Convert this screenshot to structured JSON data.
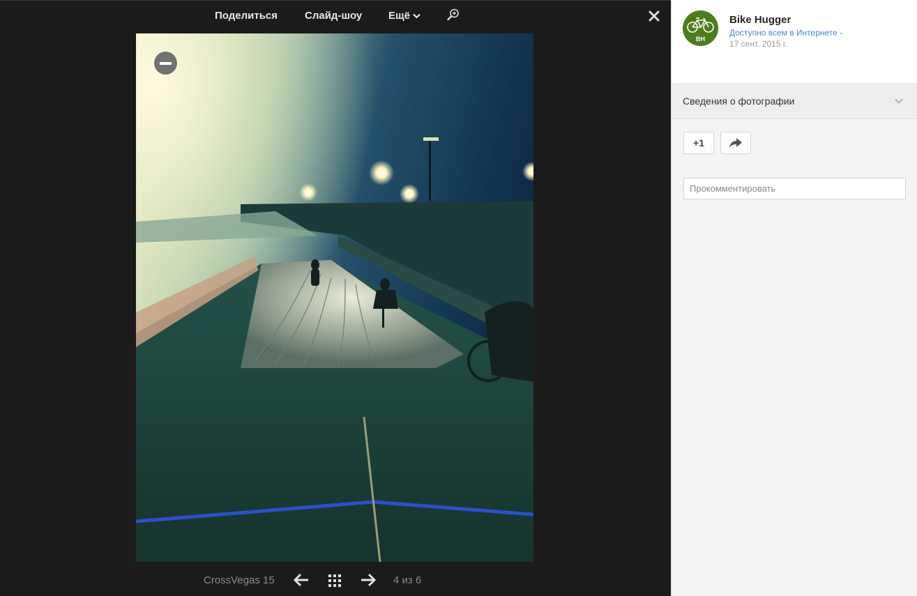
{
  "toolbar": {
    "share_label": "Поделиться",
    "slideshow_label": "Слайд-шоу",
    "more_label": "Ещё"
  },
  "viewer": {
    "album_title": "CrossVegas 15",
    "counter": "4 из 6"
  },
  "post": {
    "author": "Bike Hugger",
    "avatar_initials": "BH",
    "visibility": "Доступно всем в Интернете -",
    "date": "17 сент. 2015 г."
  },
  "details": {
    "label": "Сведения о фотографии"
  },
  "actions": {
    "plusone_label": "+1"
  },
  "comment": {
    "placeholder": "Прокомментировать"
  },
  "colors": {
    "viewer_bg": "#1b1b1b",
    "panel_bg": "#f4f4f4",
    "avatar_green": "#4d7c1c",
    "link_blue": "#4b83d6"
  },
  "icons": [
    "chevron-down-icon",
    "zoom-in-icon",
    "close-icon",
    "minus-icon",
    "arrow-left-icon",
    "grid-icon",
    "arrow-right-icon",
    "bicycle-icon",
    "share-arrow-icon"
  ]
}
